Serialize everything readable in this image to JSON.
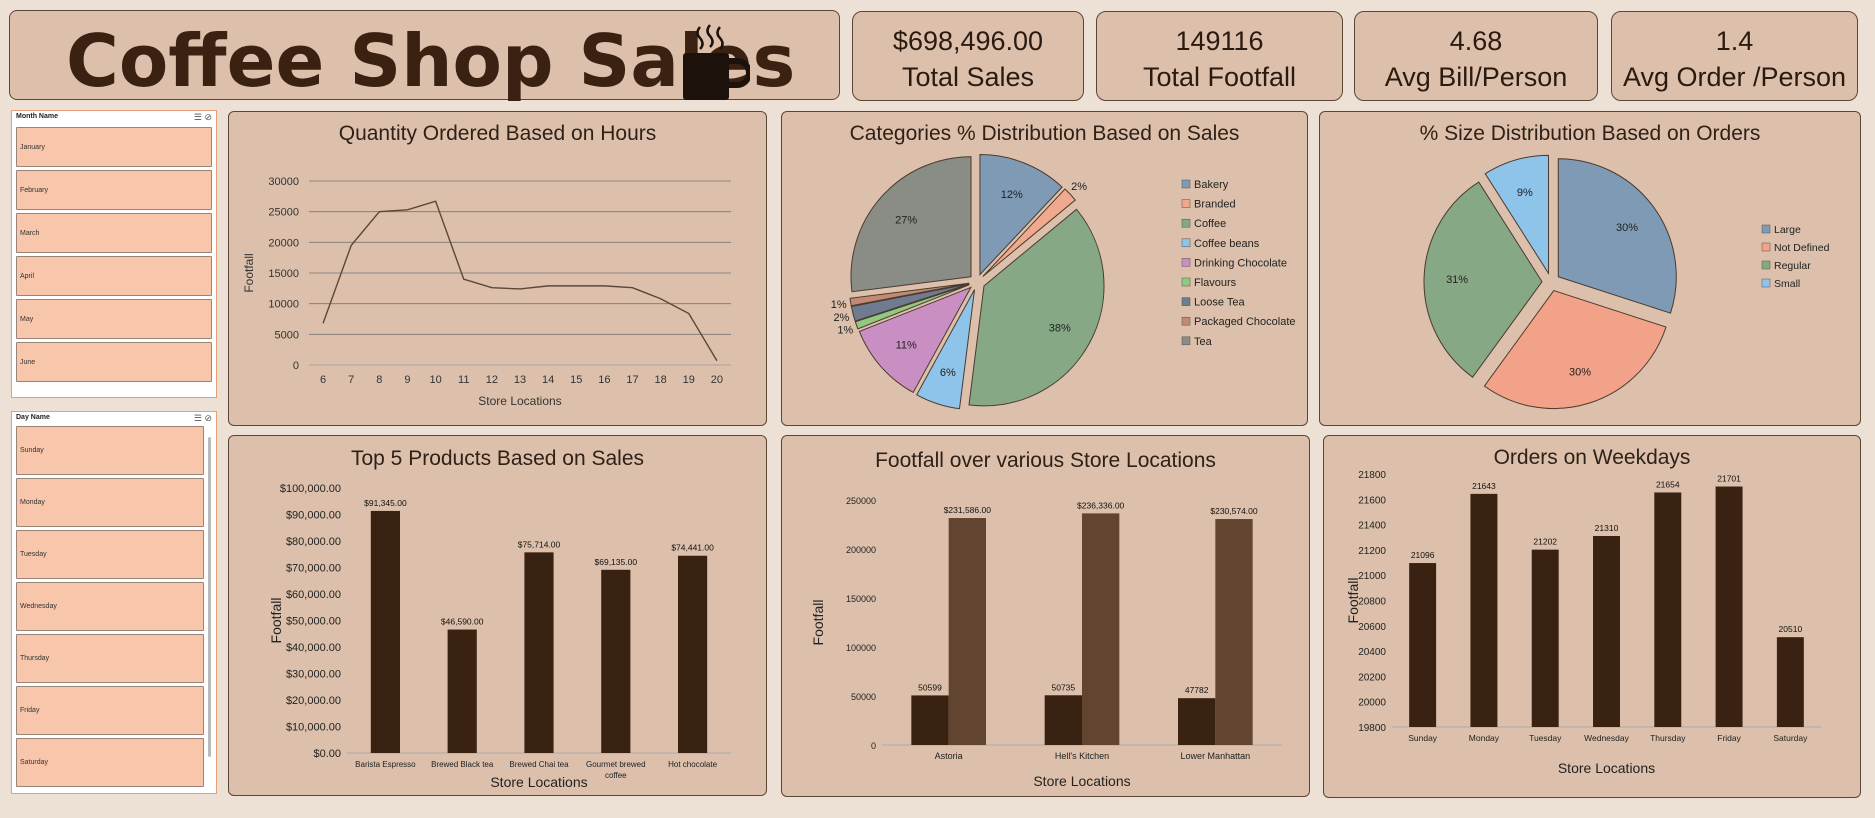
{
  "header": {
    "title": "Coffee Shop Sales",
    "icon": "coffee-mug-icon"
  },
  "kpis": [
    {
      "value": "$698,496.00",
      "label": "Total Sales"
    },
    {
      "value": "149116",
      "label": "Total Footfall"
    },
    {
      "value": "4.68",
      "label": "Avg Bill/Person"
    },
    {
      "value": "1.4",
      "label": "Avg Order /Person"
    }
  ],
  "slicers": {
    "month": {
      "header": "Month Name",
      "items": [
        "January",
        "February",
        "March",
        "April",
        "May",
        "June"
      ]
    },
    "day": {
      "header": "Day Name",
      "items": [
        "Sunday",
        "Monday",
        "Tuesday",
        "Wednesday",
        "Thursday",
        "Friday",
        "Saturday"
      ]
    }
  },
  "colors": {
    "bar_dark": "#3a2212",
    "bar_medium": "#614530",
    "panel": "#dcc0ab",
    "slicer_item": "#f7c6ab"
  },
  "chart_data": [
    {
      "id": "hours",
      "type": "line",
      "title": "Quantity Ordered Based on Hours",
      "xlabel": "Store Locations",
      "ylabel": "Footfall",
      "x": [
        6,
        7,
        8,
        9,
        10,
        11,
        12,
        13,
        14,
        15,
        16,
        17,
        18,
        19,
        20
      ],
      "values": [
        6800,
        19500,
        25000,
        25300,
        26700,
        14000,
        12600,
        12400,
        12900,
        12900,
        12900,
        12600,
        10800,
        8400,
        700
      ],
      "ylim": [
        0,
        30000
      ],
      "yticks": [
        "0",
        "5000",
        "10000",
        "15000",
        "20000",
        "25000",
        "30000"
      ],
      "grid": true
    },
    {
      "id": "categories",
      "type": "pie",
      "title": "Categories % Distribution Based on Sales",
      "legend_position": "right",
      "slices": [
        {
          "name": "Bakery",
          "value": 12,
          "label": "12%",
          "color": "#7f9ab5"
        },
        {
          "name": "Branded",
          "value": 2,
          "label": "2%",
          "color": "#f0a98c"
        },
        {
          "name": "Coffee",
          "value": 38,
          "label": "38%",
          "color": "#86a885"
        },
        {
          "name": "Coffee beans",
          "value": 6,
          "label": "6%",
          "color": "#8ec3ea"
        },
        {
          "name": "Drinking Chocolate",
          "value": 11,
          "label": "11%",
          "color": "#c98fc2"
        },
        {
          "name": "Flavours",
          "value": 1,
          "label": "1%",
          "color": "#92c97f"
        },
        {
          "name": "Loose Tea",
          "value": 2,
          "label": "2%",
          "color": "#6f7b8e"
        },
        {
          "name": "Packaged Chocolate",
          "value": 1,
          "label": "1%",
          "color": "#c08a75"
        },
        {
          "name": "Tea",
          "value": 27,
          "label": "27%",
          "color": "#8a8c86"
        }
      ]
    },
    {
      "id": "sizes",
      "type": "pie",
      "title": "% Size Distribution Based on Orders",
      "legend_position": "right",
      "slices": [
        {
          "name": "Large",
          "value": 30,
          "label": "30%",
          "color": "#7f9ab5"
        },
        {
          "name": "Not Defined",
          "value": 30,
          "label": "30%",
          "color": "#f2a288"
        },
        {
          "name": "Regular",
          "value": 31,
          "label": "31%",
          "color": "#86a885"
        },
        {
          "name": "Small",
          "value": 9,
          "label": "9%",
          "color": "#8ec3ea"
        }
      ]
    },
    {
      "id": "products",
      "type": "bar",
      "title": "Top 5 Products Based on Sales",
      "xlabel": "Store Locations",
      "ylabel": "Footfall",
      "categories": [
        "Barista Espresso",
        "Brewed Black tea",
        "Brewed Chai tea",
        "Gourmet brewed coffee",
        "Hot chocolate"
      ],
      "values": [
        91345,
        46590,
        75714,
        69135,
        74441
      ],
      "data_labels": [
        "$91,345.00",
        "$46,590.00",
        "$75,714.00",
        "$69,135.00",
        "$74,441.00"
      ],
      "ylim": [
        0,
        100000
      ],
      "yticks": [
        "$0.00",
        "$10,000.00",
        "$20,000.00",
        "$30,000.00",
        "$40,000.00",
        "$50,000.00",
        "$60,000.00",
        "$70,000.00",
        "$80,000.00",
        "$90,000.00",
        "$100,000.00"
      ]
    },
    {
      "id": "stores",
      "type": "bar",
      "title": "Footfall over various Store Locations",
      "xlabel": "Store Locations",
      "ylabel": "Footfall",
      "categories": [
        "Astoria",
        "Hell's Kitchen",
        "Lower Manhattan"
      ],
      "series": [
        {
          "values": [
            50599,
            50735,
            47782
          ],
          "data_labels": [
            "50599",
            "50735",
            "47782"
          ],
          "color": "#3a2212"
        },
        {
          "values": [
            231586,
            236336,
            230574
          ],
          "data_labels": [
            "$231,586.00",
            "$236,336.00",
            "$230,574.00"
          ],
          "color": "#614530"
        }
      ],
      "ylim": [
        0,
        250000
      ],
      "yticks": [
        "0",
        "50000",
        "100000",
        "150000",
        "200000",
        "250000"
      ]
    },
    {
      "id": "weekdays",
      "type": "bar",
      "title": "Orders on Weekdays",
      "xlabel": "Store Locations",
      "ylabel": "Footfall",
      "categories": [
        "Sunday",
        "Monday",
        "Tuesday",
        "Wednesday",
        "Thursday",
        "Friday",
        "Saturday"
      ],
      "values": [
        21096,
        21643,
        21202,
        21310,
        21654,
        21701,
        20510
      ],
      "data_labels": [
        "21096",
        "21643",
        "21202",
        "21310",
        "21654",
        "21701",
        "20510"
      ],
      "ylim": [
        19800,
        21800
      ],
      "yticks": [
        "19800",
        "20000",
        "20200",
        "20400",
        "20600",
        "20800",
        "21000",
        "21200",
        "21400",
        "21600",
        "21800"
      ]
    }
  ]
}
